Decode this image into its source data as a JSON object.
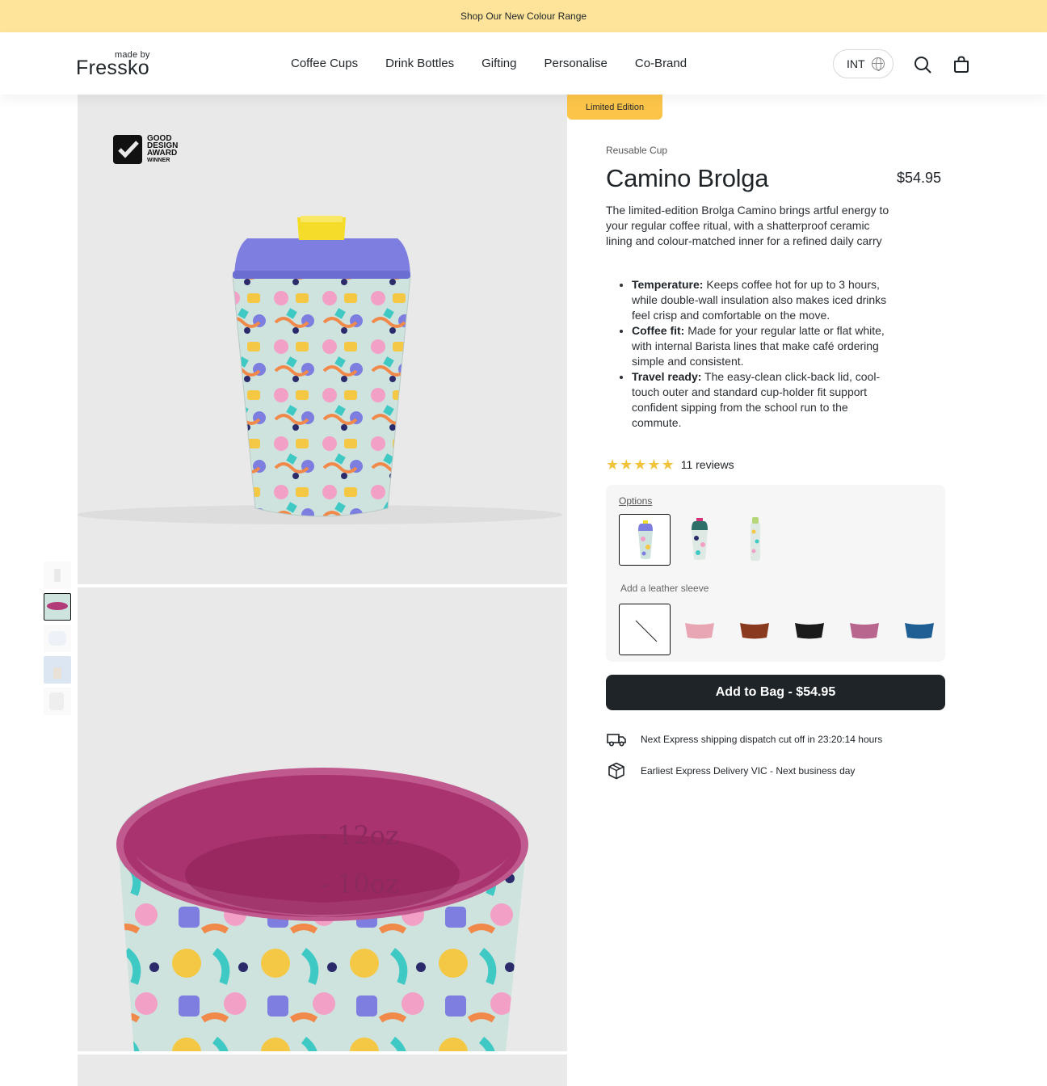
{
  "announcement": "Shop Our New Colour Range",
  "logo": {
    "made_by": "made by",
    "word": "Fressko"
  },
  "nav": [
    "Coffee Cups",
    "Drink Bottles",
    "Gifting",
    "Personalise",
    "Co-Brand"
  ],
  "region": "INT",
  "icons": {
    "globe": "globe-icon",
    "search": "search-icon",
    "bag": "bag-icon",
    "truck": "truck-icon",
    "box": "box-icon",
    "star": "star-icon"
  },
  "gallery": {
    "award": {
      "line1": "GOOD",
      "line2": "DESIGN",
      "line3": "AWARD",
      "line4": "WINNER"
    },
    "inner_markings": {
      "mark1": "- 12oz",
      "mark2": "- 10oz"
    },
    "thumbnail_count": 5,
    "selected_thumbnail": 2
  },
  "badge": "Limited Edition",
  "product": {
    "category": "Reusable Cup",
    "title": "Camino Brolga",
    "price": "$54.95",
    "description": "The limited-edition Brolga Camino brings artful energy to your regular coffee ritual, with a shatterproof ceramic lining and colour-matched inner for a refined daily carry",
    "bullets": [
      {
        "label": "Temperature:",
        "text": " Keeps coffee hot for up to 3 hours, while double-wall insulation also makes iced drinks feel crisp and comfortable on the move."
      },
      {
        "label": "Coffee fit:",
        "text": " Made for your regular latte or flat white, with internal Barista lines that make café ordering simple and consistent."
      },
      {
        "label": "Travel ready:",
        "text": " The easy-clean click-back lid, cool-touch outer and standard cup-holder fit support confident sipping from the school run to the commute."
      }
    ],
    "rating": 5,
    "reviews": "11 reviews"
  },
  "options": {
    "label": "Options",
    "selected": 0,
    "sleeve_label": "Add a leather sleeve",
    "sleeve_colors": [
      "none",
      "#e8a6b4",
      "#8a3a1e",
      "#1b1b1b",
      "#b8668e",
      "#1f5f94"
    ]
  },
  "cta": "Add to Bag - $54.95",
  "shipping": [
    "Next Express shipping dispatch cut off in 23:20:14 hours",
    "Earliest Express Delivery VIC - Next business day"
  ],
  "colors": {
    "announcement_bg": "#fde49a",
    "badge_bg": "#fcc54a",
    "cta_bg": "#1f2428",
    "star": "#f2c43d",
    "lid": "#7d7ee0",
    "lid_button": "#f5dc2a",
    "inner": "#b13a78"
  }
}
